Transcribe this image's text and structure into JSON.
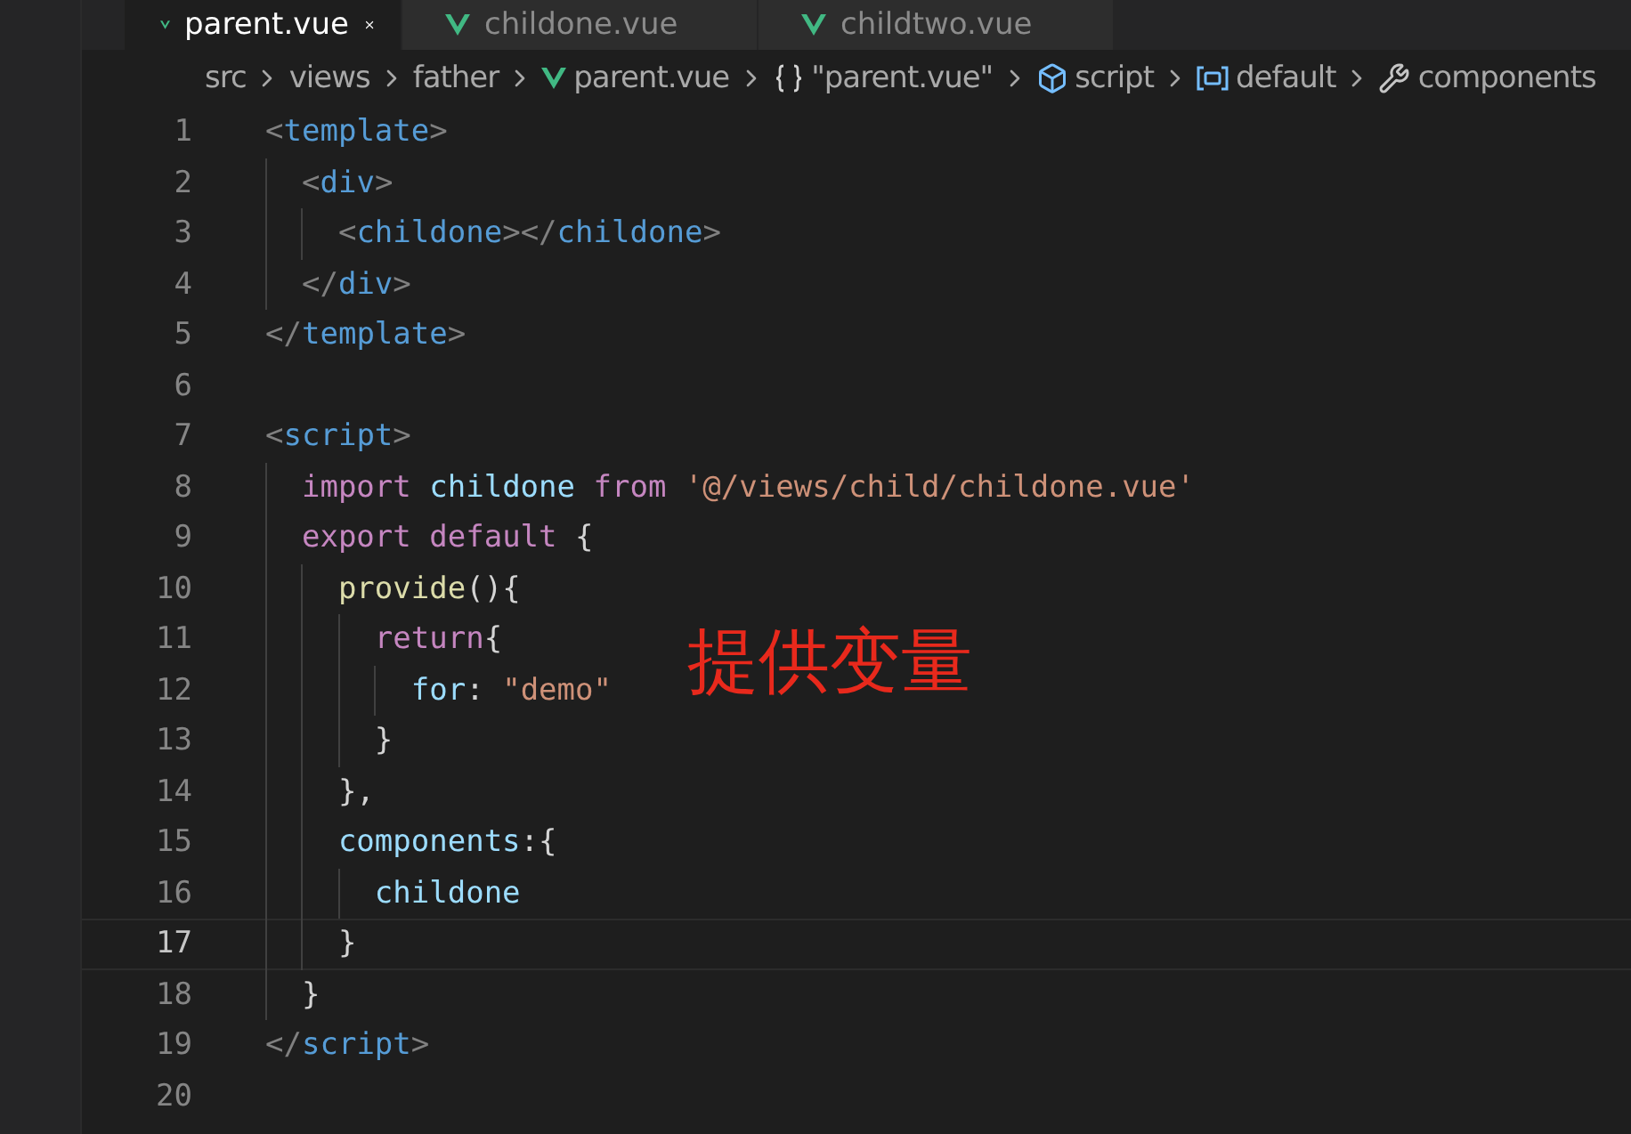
{
  "tabs": [
    {
      "label": "parent.vue",
      "selected": true
    },
    {
      "label": "childone.vue",
      "selected": false
    },
    {
      "label": "childtwo.vue",
      "selected": false
    }
  ],
  "breadcrumb": [
    {
      "label": "src",
      "kind": "folder"
    },
    {
      "label": "views",
      "kind": "folder"
    },
    {
      "label": "father",
      "kind": "folder"
    },
    {
      "label": "parent.vue",
      "kind": "vue"
    },
    {
      "label": "\"parent.vue\"",
      "kind": "object"
    },
    {
      "label": "script",
      "kind": "module"
    },
    {
      "label": "default",
      "kind": "variable"
    },
    {
      "label": "components",
      "kind": "method"
    }
  ],
  "lines": [
    {
      "number": "1",
      "current": false,
      "tokens": [
        {
          "t": "<",
          "kind": "punct"
        },
        {
          "t": "template",
          "kind": "tag"
        },
        {
          "t": ">",
          "kind": "punct"
        }
      ],
      "children": [
        {
          "number": "2",
          "current": false,
          "tokens": [
            {
              "t": "<",
              "kind": "punct"
            },
            {
              "t": "div",
              "kind": "tag"
            },
            {
              "t": ">",
              "kind": "punct"
            }
          ],
          "children": [
            {
              "number": "3",
              "current": false,
              "tokens": [
                {
                  "t": "<",
                  "kind": "punct"
                },
                {
                  "t": "childone",
                  "kind": "tag"
                },
                {
                  "t": "></",
                  "kind": "punct"
                },
                {
                  "t": "childone",
                  "kind": "tag"
                },
                {
                  "t": ">",
                  "kind": "punct"
                }
              ]
            }
          ]
        },
        {
          "number": "4",
          "current": false,
          "tokens": [
            {
              "t": "</",
              "kind": "punct"
            },
            {
              "t": "div",
              "kind": "tag"
            },
            {
              "t": ">",
              "kind": "punct"
            }
          ]
        }
      ]
    },
    {
      "number": "5",
      "current": false,
      "tokens": [
        {
          "t": "</",
          "kind": "punct"
        },
        {
          "t": "template",
          "kind": "tag"
        },
        {
          "t": ">",
          "kind": "punct"
        }
      ]
    },
    {
      "number": "6",
      "current": false
    },
    {
      "number": "7",
      "current": false,
      "tokens": [
        {
          "t": "<",
          "kind": "punct"
        },
        {
          "t": "script",
          "kind": "tag"
        },
        {
          "t": ">",
          "kind": "punct"
        }
      ],
      "children": [
        {
          "number": "8",
          "current": false,
          "tokens": [
            {
              "t": "import",
              "kind": "keyword"
            },
            {
              "t": " childone",
              "kind": "ident"
            },
            {
              "t": " from",
              "kind": "keyword"
            },
            {
              "t": " '@/views/child/childone.vue'",
              "kind": "string"
            }
          ]
        },
        {
          "number": "9",
          "current": false,
          "tokens": [
            {
              "t": "export",
              "kind": "keyword"
            },
            {
              "t": " default",
              "kind": "keyword"
            },
            {
              "t": " {",
              "kind": "plain"
            }
          ],
          "children": [
            {
              "number": "10",
              "current": false,
              "tokens": [
                {
                  "t": "provide",
                  "kind": "func"
                },
                {
                  "t": "(){",
                  "kind": "plain"
                }
              ],
              "children": [
                {
                  "number": "11",
                  "current": false,
                  "tokens": [
                    {
                      "t": "return",
                      "kind": "keyword"
                    },
                    {
                      "t": "{",
                      "kind": "plain"
                    }
                  ],
                  "children": [
                    {
                      "number": "12",
                      "current": false,
                      "tokens": [
                        {
                          "t": "for",
                          "kind": "ident"
                        },
                        {
                          "t": ":",
                          "kind": "plain"
                        },
                        {
                          "t": " \"demo\"",
                          "kind": "string"
                        }
                      ]
                    }
                  ]
                },
                {
                  "number": "13",
                  "current": false,
                  "tokens": [
                    {
                      "t": "}",
                      "kind": "plain"
                    }
                  ]
                }
              ]
            },
            {
              "number": "14",
              "current": false,
              "tokens": [
                {
                  "t": "},",
                  "kind": "plain"
                }
              ]
            },
            {
              "number": "15",
              "current": false,
              "tokens": [
                {
                  "t": "components",
                  "kind": "ident"
                },
                {
                  "t": ":{",
                  "kind": "plain"
                }
              ],
              "children": [
                {
                  "number": "16",
                  "current": false,
                  "tokens": [
                    {
                      "t": "childone",
                      "kind": "ident"
                    }
                  ]
                }
              ]
            },
            {
              "number": "17",
              "current": true,
              "tokens": [
                {
                  "t": "}",
                  "kind": "plain"
                }
              ]
            }
          ]
        },
        {
          "number": "18",
          "current": false,
          "tokens": [
            {
              "t": "}",
              "kind": "plain"
            }
          ]
        }
      ]
    },
    {
      "number": "19",
      "current": false,
      "tokens": [
        {
          "t": "</",
          "kind": "punct"
        },
        {
          "t": "script",
          "kind": "tag"
        },
        {
          "t": ">",
          "kind": "punct"
        }
      ]
    },
    {
      "number": "20",
      "current": false
    }
  ],
  "annotation": "提供变量"
}
